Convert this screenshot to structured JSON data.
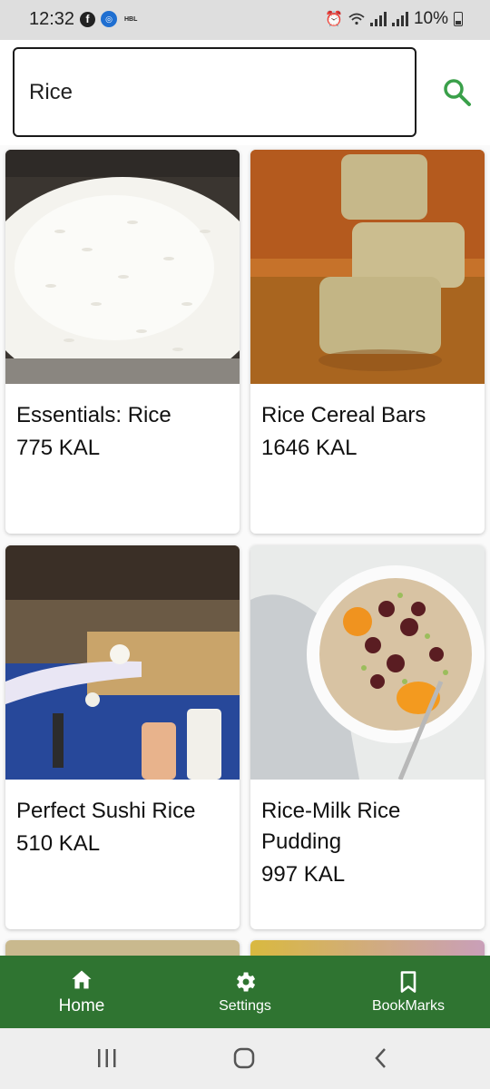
{
  "status_bar": {
    "time": "12:32",
    "battery": "10%",
    "hbl_label": "HBL"
  },
  "search": {
    "value": "Rice",
    "placeholder": "Search"
  },
  "recipes": [
    {
      "title": "Essentials: Rice",
      "calories": "775 KAL"
    },
    {
      "title": "Rice Cereal Bars",
      "calories": "1646 KAL"
    },
    {
      "title": "Perfect Sushi Rice",
      "calories": "510 KAL"
    },
    {
      "title": "Rice-Milk Rice Pudding",
      "calories": "997 KAL"
    }
  ],
  "bottom_nav": {
    "home": "Home",
    "settings": "Settings",
    "bookmarks": "BookMarks"
  },
  "colors": {
    "nav_bg": "#2f7431",
    "search_icon": "#3aa04a"
  },
  "icons": {
    "search": "search-icon",
    "home": "home-icon",
    "settings": "gear-icon",
    "bookmarks": "bookmark-icon"
  }
}
